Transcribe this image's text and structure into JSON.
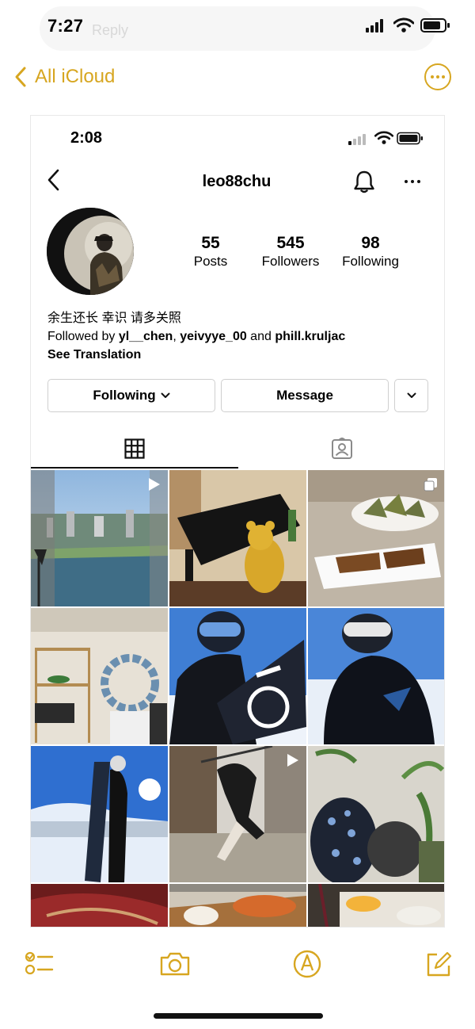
{
  "status_bar": {
    "time": "7:27",
    "ghost_text": "Reply"
  },
  "notes_nav": {
    "back_label": "All iCloud",
    "accent": "#d7a620",
    "back_icon": "chevron-left-icon",
    "more_icon": "ellipsis-circle-icon"
  },
  "instagram": {
    "status_time": "2:08",
    "username": "leo88chu",
    "stats": [
      {
        "value": "55",
        "label": "Posts"
      },
      {
        "value": "545",
        "label": "Followers"
      },
      {
        "value": "98",
        "label": "Following"
      }
    ],
    "bio": "余生还长 幸识 请多关照",
    "followed_by": {
      "prefix": "Followed by ",
      "names": [
        "yl__chen",
        "yeivyye_00",
        "phill.kruljac"
      ],
      "sep": ", ",
      "and": " and "
    },
    "see_translation": "See Translation",
    "buttons": {
      "following": "Following",
      "message": "Message"
    },
    "tabs": [
      "grid-tab",
      "tagged-tab"
    ],
    "posts": [
      {
        "name": "post-city-view",
        "kind": "reel"
      },
      {
        "name": "post-piano-bear",
        "kind": "photo"
      },
      {
        "name": "post-zongzi",
        "kind": "carousel"
      },
      {
        "name": "post-shelf-decor",
        "kind": "photo"
      },
      {
        "name": "post-snowboard-selfie",
        "kind": "photo"
      },
      {
        "name": "post-ski-jacket",
        "kind": "photo"
      },
      {
        "name": "post-burton-board",
        "kind": "photo"
      },
      {
        "name": "post-gym",
        "kind": "reel"
      },
      {
        "name": "post-plants-chairs",
        "kind": "photo"
      },
      {
        "name": "post-car-interior",
        "kind": "photo"
      },
      {
        "name": "post-food-tray",
        "kind": "photo"
      },
      {
        "name": "post-restaurant-table",
        "kind": "photo"
      }
    ]
  },
  "toolbar": {
    "icons": [
      "checklist-icon",
      "camera-icon",
      "markup-pen-icon",
      "compose-icon"
    ],
    "accent": "#d7a620"
  }
}
